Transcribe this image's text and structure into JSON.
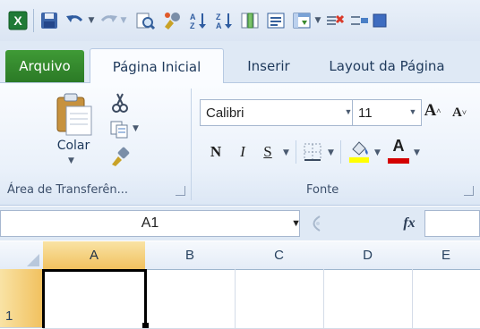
{
  "tabs": [
    "Arquivo",
    "Página Inicial",
    "Inserir",
    "Layout da Página"
  ],
  "ribbon": {
    "paste_label": "Colar",
    "clipboard_group": "Área de Transferên...",
    "font_group": "Fonte",
    "font_name": "Calibri",
    "font_size": "11",
    "bold": "N",
    "italic": "I",
    "underline": "S",
    "grow_font": "A",
    "shrink_font": "A",
    "font_color": "A"
  },
  "formula_bar": {
    "name_box": "A1",
    "fx": "fx"
  },
  "grid": {
    "columns": [
      "A",
      "B",
      "C",
      "D",
      "E"
    ],
    "rows": [
      "1"
    ]
  },
  "colors": {
    "file_tab": "#2f8a2a",
    "highlight_yellow": "#ffff00",
    "font_red": "#d40000",
    "selected_header": "#f1c15f"
  }
}
